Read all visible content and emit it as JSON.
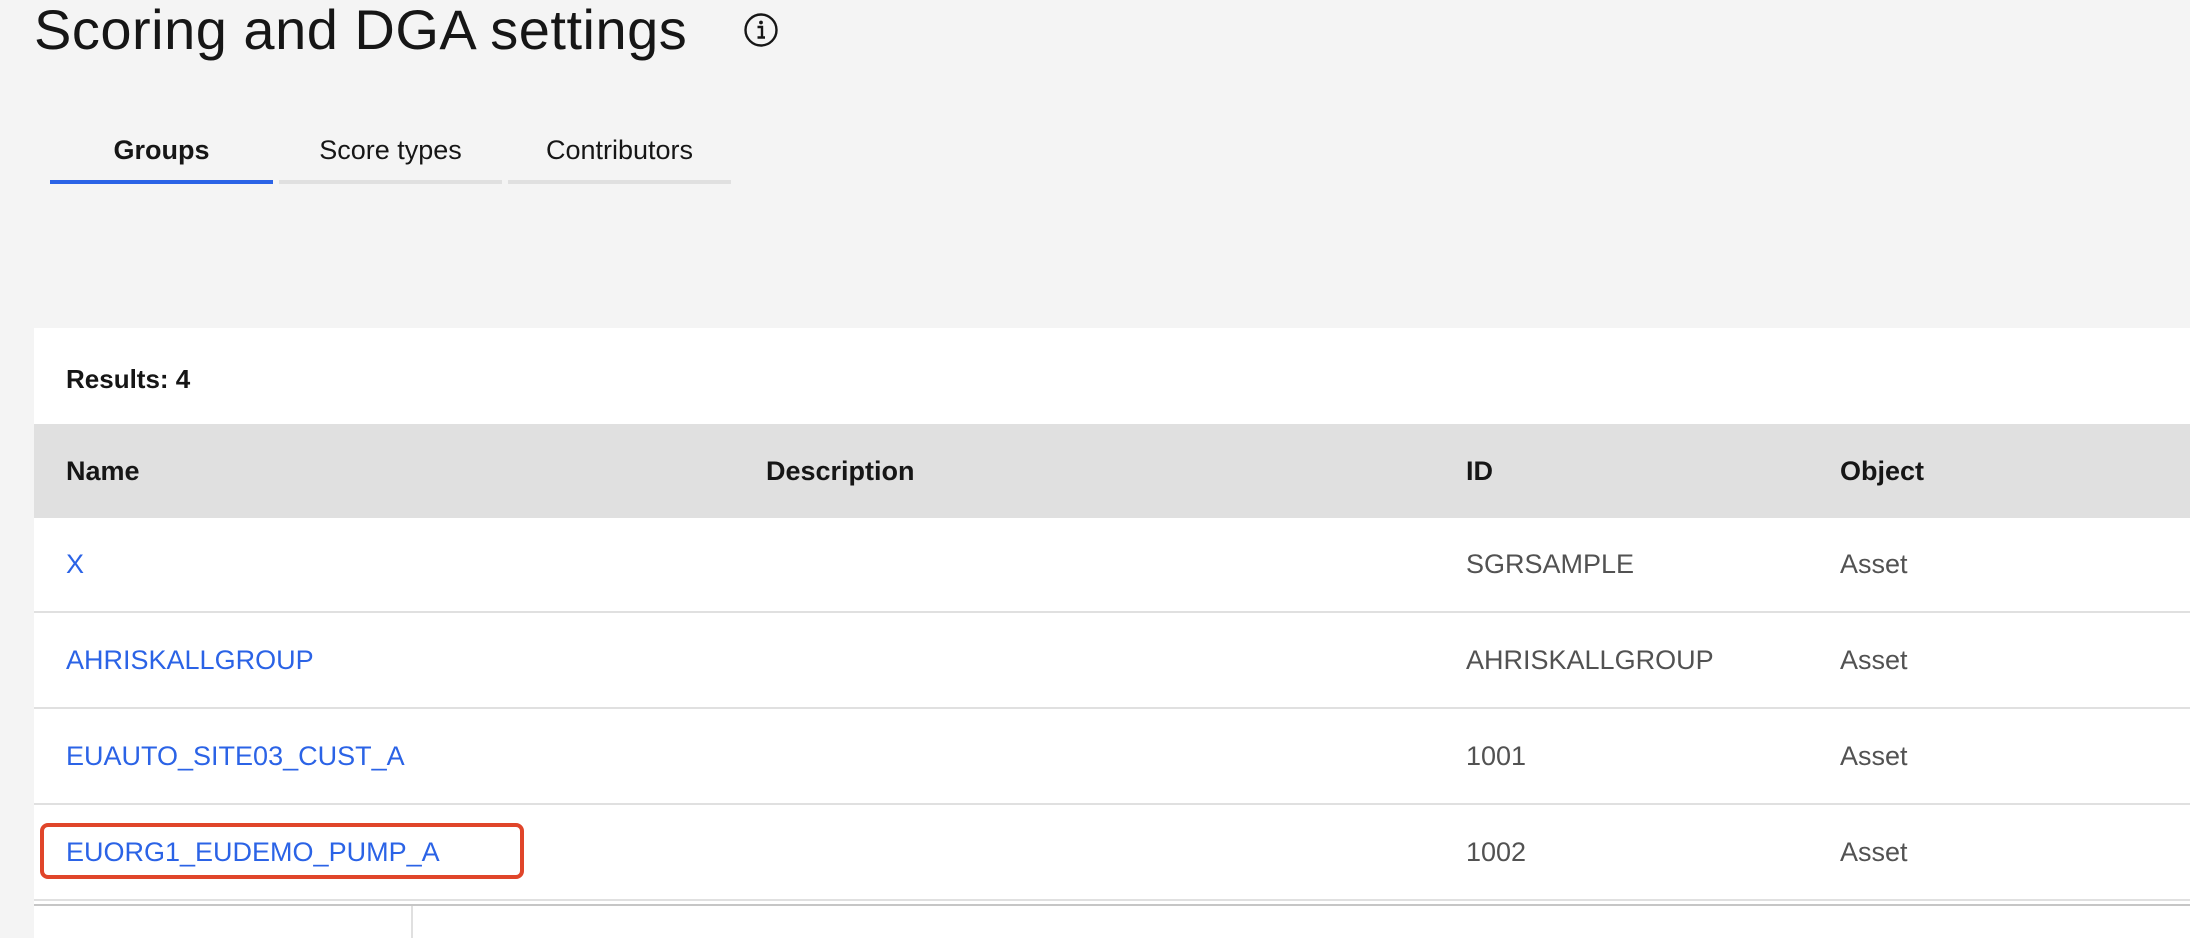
{
  "page": {
    "title": "Scoring and DGA settings",
    "info_icon": "info-circle-icon"
  },
  "tabs": [
    {
      "label": "Groups",
      "active": true
    },
    {
      "label": "Score types",
      "active": false
    },
    {
      "label": "Contributors",
      "active": false
    }
  ],
  "table": {
    "results_label": "Results: 4",
    "columns": [
      "Name",
      "Description",
      "ID",
      "Object"
    ],
    "rows": [
      {
        "name": "X",
        "description": "",
        "id": "SGRSAMPLE",
        "object": "Asset"
      },
      {
        "name": "AHRISKALLGROUP",
        "description": "",
        "id": "AHRISKALLGROUP",
        "object": "Asset"
      },
      {
        "name": "EUAUTO_SITE03_CUST_A",
        "description": "",
        "id": "1001",
        "object": "Asset"
      },
      {
        "name": "EUORG1_EUDEMO_PUMP_A",
        "description": "",
        "id": "1002",
        "object": "Asset"
      }
    ]
  },
  "colors": {
    "link": "#2b63e6",
    "active_tab_underline": "#2b63e6",
    "highlight_box": "#e0452a",
    "header_bg": "#e0e0e0",
    "page_bg": "#f4f4f4"
  }
}
